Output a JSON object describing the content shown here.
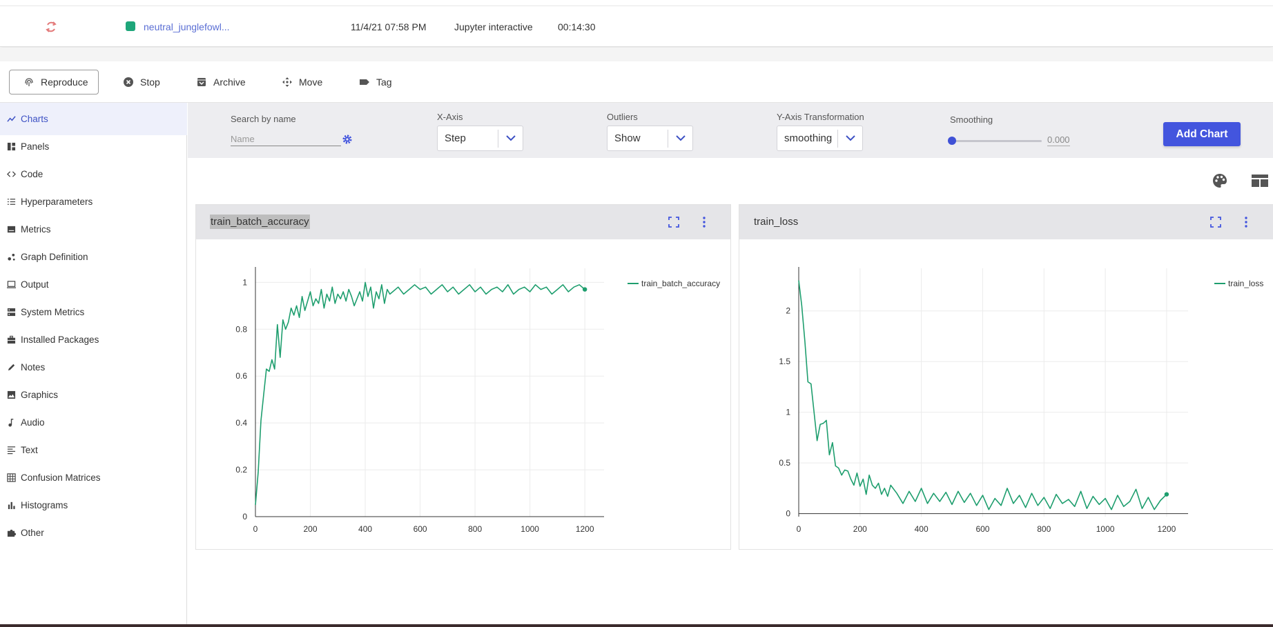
{
  "experiment_row": {
    "name": "neutral_junglefowl...",
    "date": "11/4/21 07:58 PM",
    "type": "Jupyter interactive",
    "duration": "00:14:30",
    "status_color": "#1ea67a"
  },
  "toolbar": {
    "reproduce": "Reproduce",
    "stop": "Stop",
    "archive": "Archive",
    "move": "Move",
    "tag": "Tag"
  },
  "sidebar": {
    "items": [
      {
        "label": "Charts",
        "icon": "chart-line-icon",
        "active": true
      },
      {
        "label": "Panels",
        "icon": "panels-icon"
      },
      {
        "label": "Code",
        "icon": "code-icon"
      },
      {
        "label": "Hyperparameters",
        "icon": "list-icon"
      },
      {
        "label": "Metrics",
        "icon": "metrics-icon"
      },
      {
        "label": "Graph Definition",
        "icon": "graph-icon"
      },
      {
        "label": "Output",
        "icon": "monitor-icon"
      },
      {
        "label": "System Metrics",
        "icon": "server-icon"
      },
      {
        "label": "Installed Packages",
        "icon": "package-icon"
      },
      {
        "label": "Notes",
        "icon": "pencil-icon"
      },
      {
        "label": "Graphics",
        "icon": "image-icon"
      },
      {
        "label": "Audio",
        "icon": "music-note-icon"
      },
      {
        "label": "Text",
        "icon": "text-icon"
      },
      {
        "label": "Confusion Matrices",
        "icon": "grid-icon"
      },
      {
        "label": "Histograms",
        "icon": "histogram-icon"
      },
      {
        "label": "Other",
        "icon": "puzzle-icon"
      }
    ]
  },
  "filters": {
    "search_label": "Search by name",
    "search_placeholder": "Name",
    "xaxis_label": "X-Axis",
    "xaxis_value": "Step",
    "outliers_label": "Outliers",
    "outliers_value": "Show",
    "yaxis_label": "Y-Axis Transformation",
    "yaxis_value": "smoothing",
    "smoothing_label": "Smoothing",
    "smoothing_value": "0.000",
    "smoothing_fraction": 0,
    "add_chart": "Add Chart"
  },
  "colors": {
    "accent": "#4355de",
    "series": "#1e9e6e"
  },
  "chart_data": [
    {
      "type": "line",
      "title": "train_batch_accuracy",
      "xlabel": "",
      "ylabel": "",
      "xlim": [
        0,
        1270
      ],
      "ylim": [
        0,
        1.06
      ],
      "x_ticks": [
        0,
        200,
        400,
        600,
        800,
        1000,
        1200
      ],
      "y_ticks": [
        0,
        0.2,
        0.4,
        0.6,
        0.8,
        1
      ],
      "y_tick_labels": [
        "0",
        "0.2",
        "0.4",
        "0.6",
        "0.8",
        "1"
      ],
      "legend": "top-right",
      "series": [
        {
          "name": "train_batch_accuracy",
          "x": [
            0,
            10,
            20,
            30,
            40,
            50,
            60,
            70,
            80,
            90,
            100,
            110,
            120,
            130,
            140,
            150,
            160,
            170,
            180,
            190,
            200,
            210,
            220,
            230,
            240,
            250,
            260,
            270,
            280,
            290,
            300,
            310,
            320,
            330,
            340,
            350,
            360,
            370,
            380,
            390,
            400,
            410,
            420,
            430,
            440,
            450,
            460,
            470,
            480,
            490,
            500,
            520,
            540,
            560,
            580,
            600,
            620,
            640,
            660,
            680,
            700,
            720,
            740,
            760,
            780,
            800,
            820,
            840,
            860,
            880,
            900,
            920,
            940,
            960,
            980,
            1000,
            1020,
            1040,
            1060,
            1080,
            1100,
            1120,
            1140,
            1160,
            1180,
            1200
          ],
          "values": [
            0.05,
            0.19,
            0.41,
            0.52,
            0.63,
            0.62,
            0.67,
            0.63,
            0.82,
            0.68,
            0.84,
            0.8,
            0.83,
            0.89,
            0.86,
            0.9,
            0.85,
            0.94,
            0.88,
            0.92,
            0.96,
            0.9,
            0.93,
            0.91,
            0.97,
            0.89,
            0.95,
            0.92,
            0.98,
            0.91,
            0.95,
            0.93,
            0.96,
            0.92,
            0.97,
            0.94,
            0.9,
            0.93,
            0.96,
            0.92,
            1.0,
            0.94,
            0.98,
            0.89,
            0.96,
            0.93,
            0.99,
            0.91,
            0.97,
            0.95,
            0.96,
            0.98,
            0.95,
            0.97,
            0.99,
            0.97,
            0.98,
            0.95,
            0.97,
            0.99,
            0.96,
            0.98,
            0.95,
            0.97,
            0.99,
            0.96,
            0.98,
            0.95,
            0.97,
            0.98,
            0.96,
            0.99,
            0.95,
            0.97,
            0.98,
            0.96,
            0.99,
            0.97,
            0.98,
            0.95,
            0.97,
            0.99,
            0.96,
            0.98,
            0.99,
            0.97
          ]
        }
      ]
    },
    {
      "type": "line",
      "title": "train_loss",
      "xlabel": "",
      "ylabel": "",
      "xlim": [
        0,
        1270
      ],
      "ylim": [
        -0.03,
        2.42
      ],
      "x_ticks": [
        0,
        200,
        400,
        600,
        800,
        1000,
        1200
      ],
      "y_ticks": [
        0,
        0.5,
        1,
        1.5,
        2
      ],
      "y_tick_labels": [
        "0",
        "0.5",
        "1",
        "1.5",
        "2"
      ],
      "legend": "top-right",
      "series": [
        {
          "name": "train_loss",
          "x": [
            0,
            10,
            20,
            30,
            40,
            50,
            60,
            70,
            80,
            90,
            100,
            110,
            120,
            130,
            140,
            150,
            160,
            170,
            180,
            190,
            200,
            210,
            220,
            230,
            240,
            250,
            260,
            270,
            280,
            290,
            300,
            320,
            340,
            360,
            380,
            400,
            420,
            440,
            460,
            480,
            500,
            520,
            540,
            560,
            580,
            600,
            620,
            640,
            660,
            680,
            700,
            720,
            740,
            760,
            780,
            800,
            820,
            840,
            860,
            880,
            900,
            920,
            940,
            960,
            980,
            1000,
            1020,
            1040,
            1060,
            1080,
            1100,
            1120,
            1140,
            1160,
            1180,
            1200
          ],
          "values": [
            2.3,
            2.05,
            1.7,
            1.3,
            1.28,
            1.0,
            0.72,
            0.88,
            0.89,
            0.92,
            0.58,
            0.7,
            0.47,
            0.45,
            0.38,
            0.43,
            0.42,
            0.34,
            0.28,
            0.4,
            0.27,
            0.34,
            0.19,
            0.38,
            0.28,
            0.25,
            0.3,
            0.19,
            0.25,
            0.17,
            0.28,
            0.2,
            0.1,
            0.22,
            0.12,
            0.25,
            0.1,
            0.2,
            0.12,
            0.21,
            0.09,
            0.22,
            0.11,
            0.2,
            0.08,
            0.18,
            0.04,
            0.15,
            0.08,
            0.25,
            0.1,
            0.18,
            0.06,
            0.2,
            0.08,
            0.16,
            0.05,
            0.19,
            0.1,
            0.14,
            0.07,
            0.22,
            0.05,
            0.17,
            0.09,
            0.15,
            0.04,
            0.18,
            0.07,
            0.12,
            0.24,
            0.05,
            0.16,
            0.04,
            0.13,
            0.19
          ]
        }
      ]
    }
  ]
}
